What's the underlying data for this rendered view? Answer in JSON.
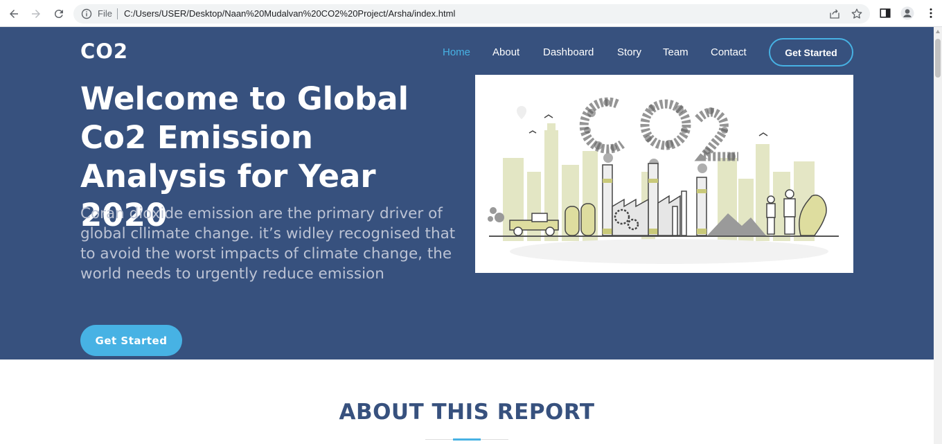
{
  "browser": {
    "file_label": "File",
    "url": "C:/Users/USER/Desktop/Naan%20Mudalvan%20CO2%20Project/Arsha/index.html"
  },
  "site": {
    "logo": "CO2",
    "nav": [
      {
        "label": "Home",
        "active": true
      },
      {
        "label": "About",
        "active": false
      },
      {
        "label": "Dashboard",
        "active": false
      },
      {
        "label": "Story",
        "active": false
      },
      {
        "label": "Team",
        "active": false
      },
      {
        "label": "Contact",
        "active": false
      }
    ],
    "nav_cta": "Get Started"
  },
  "hero": {
    "title": "Welcome to Global Co2 Emission Analysis for Year 2020",
    "subtitle": "Coran dioxide emission are the primary driver of global cllimate change. it’s widley recognised that to avoid the worst impacts of climate change, the world needs to urgently reduce emission",
    "button": "Get Started",
    "illustration_text": "CO2"
  },
  "about": {
    "title": "ABOUT THIS REPORT"
  },
  "colors": {
    "hero_bg": "#37517e",
    "accent": "#47b2e4",
    "subtitle": "#bcc3d4"
  }
}
